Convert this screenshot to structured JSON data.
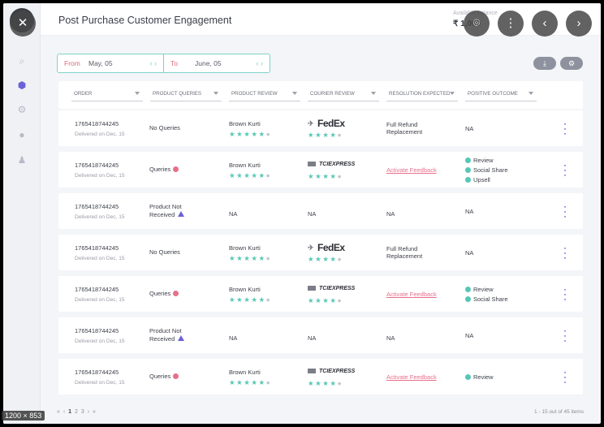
{
  "header": {
    "title": "Post Purchase Customer Engagement",
    "avail_label": "Available balance",
    "amount": "₹ 1,000"
  },
  "overlay": {
    "close": "✕",
    "lens": "⌾",
    "more": "⋮",
    "prev": "‹",
    "next": "›"
  },
  "datebar": {
    "from_label": "From",
    "from_value": "May, 05",
    "to_label": "To",
    "to_value": "June, 05",
    "arrows": "‹ ›"
  },
  "toolbar": {
    "download_icon": "download-icon",
    "settings_icon": "gear-icon"
  },
  "columns": [
    "ORDER",
    "PRODUCT QUERIES",
    "PRODUCT REVIEW",
    "COURIER REVIEW",
    "RESOLUTION EXPECTED",
    "POSITIVE OUTCOME"
  ],
  "rows": [
    {
      "order_id": "1765418744245",
      "delivered": "Delivered on Dec, 15",
      "query": "No Queries",
      "review": "Brown Kurti",
      "courier": "FedEx",
      "resolution": "Full Refund\nReplacement",
      "outcomes": [
        "NA"
      ]
    },
    {
      "order_id": "1765418744245",
      "delivered": "Delivered on Dec, 15",
      "query": "Queries",
      "review": "Brown Kurti",
      "courier": "TCIEXPRESS",
      "resolution": "Activate Feedback",
      "outcomes": [
        "Review",
        "Social Share",
        "Upsell"
      ]
    },
    {
      "order_id": "1765418744245",
      "delivered": "Delivered on Dec, 15",
      "query": "Product Not\nReceived",
      "review": "NA",
      "courier": "NA",
      "resolution": "NA",
      "outcomes": [
        "NA"
      ]
    },
    {
      "order_id": "1765418744245",
      "delivered": "Delivered on Dec, 15",
      "query": "No Queries",
      "review": "Brown Kurti",
      "courier": "FedEx",
      "resolution": "Full Refund\nReplacement",
      "outcomes": [
        "NA"
      ]
    },
    {
      "order_id": "1765418744245",
      "delivered": "Delivered on Dec, 15",
      "query": "Queries",
      "review": "Brown Kurti",
      "courier": "TCIEXPRESS",
      "resolution": "Activate Feedback",
      "outcomes": [
        "Review",
        "Social Share"
      ]
    },
    {
      "order_id": "1765418744245",
      "delivered": "Delivered on Dec, 15",
      "query": "Product Not\nReceived",
      "review": "NA",
      "courier": "NA",
      "resolution": "NA",
      "outcomes": [
        "NA"
      ]
    },
    {
      "order_id": "1765418744245",
      "delivered": "Delivered on Dec, 15",
      "query": "Queries",
      "review": "Brown Kurti",
      "courier": "TCIEXPRESS",
      "resolution": "Activate Feedback",
      "outcomes": [
        "Review"
      ]
    }
  ],
  "fedex": {
    "fed": "Fed",
    "ex": "Ex"
  },
  "stars_text": "★★★★★",
  "stars_four": "★★★★",
  "stars_gray": "●",
  "pager": {
    "first": "«",
    "prev": "‹",
    "pages": [
      "1",
      "2",
      "3"
    ],
    "next": "›",
    "last": "»"
  },
  "count": "1 - 15 out of 45 items",
  "size_tag": "1200 × 853",
  "colors": {
    "accent": "#6a62d8",
    "teal": "#56c7b6",
    "pink": "#e86f8b"
  }
}
